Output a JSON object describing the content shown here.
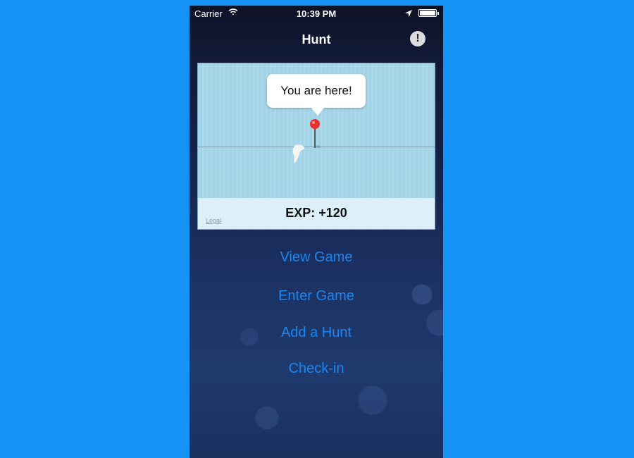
{
  "status_bar": {
    "carrier": "Carrier",
    "time": "10:39 PM"
  },
  "nav": {
    "title": "Hunt",
    "alert_icon": "!"
  },
  "map": {
    "callout": "You are here!",
    "exp": "EXP: +120",
    "legal": "Legal"
  },
  "menu": [
    {
      "label": "View Game"
    },
    {
      "label": "Enter Game"
    },
    {
      "label": "Add a Hunt"
    },
    {
      "label": "Check-in"
    }
  ],
  "colors": {
    "background": "#1592f6",
    "link": "#1a86f2",
    "pin": "#e8302c"
  }
}
